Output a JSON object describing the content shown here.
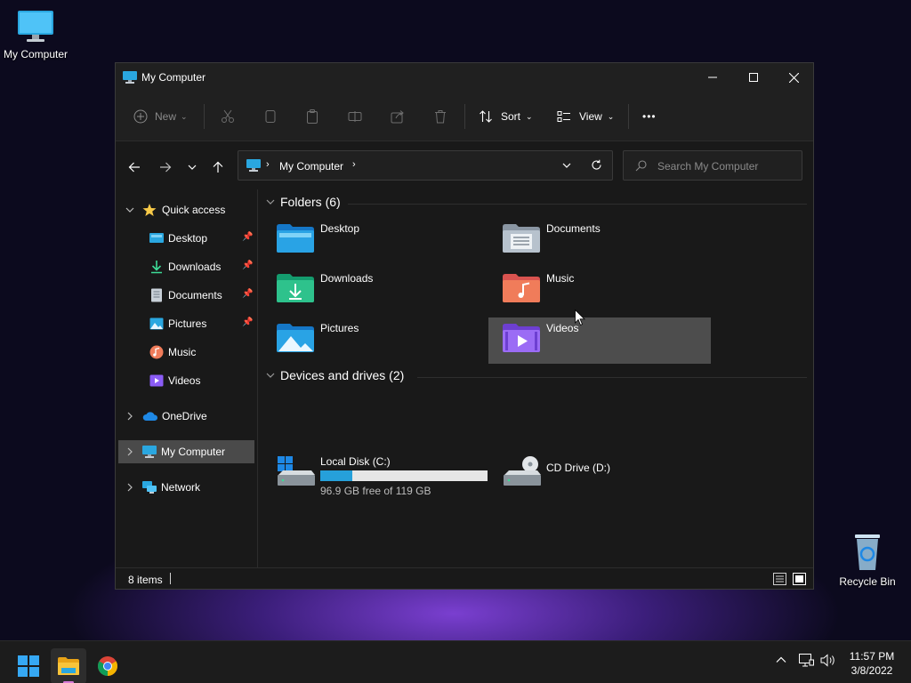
{
  "desktop": {
    "icons": [
      {
        "label": "My Computer",
        "icon": "monitor-icon"
      },
      {
        "label": "Recycle Bin",
        "icon": "recycle-bin-icon"
      }
    ]
  },
  "window": {
    "title": "My Computer",
    "controls": {
      "minimize": "minimize",
      "maximize": "maximize",
      "close": "close"
    }
  },
  "toolbar": {
    "new_label": "New",
    "sort_label": "Sort",
    "view_label": "View",
    "more_label": "•••"
  },
  "address": {
    "crumb": "My Computer",
    "search_placeholder": "Search My Computer"
  },
  "sidebar": {
    "quick_access": "Quick access",
    "quick_items": [
      {
        "label": "Desktop",
        "icon": "desktop-folder-icon"
      },
      {
        "label": "Downloads",
        "icon": "downloads-icon"
      },
      {
        "label": "Documents",
        "icon": "documents-icon"
      },
      {
        "label": "Pictures",
        "icon": "pictures-icon"
      },
      {
        "label": "Music",
        "icon": "music-icon"
      },
      {
        "label": "Videos",
        "icon": "videos-icon"
      }
    ],
    "onedrive": "OneDrive",
    "my_computer": "My Computer",
    "network": "Network"
  },
  "content": {
    "folders_header": "Folders (6)",
    "folders": [
      {
        "name": "Desktop",
        "icon": "desktop-folder-icon"
      },
      {
        "name": "Documents",
        "icon": "documents-folder-icon"
      },
      {
        "name": "Downloads",
        "icon": "downloads-folder-icon"
      },
      {
        "name": "Music",
        "icon": "music-folder-icon"
      },
      {
        "name": "Pictures",
        "icon": "pictures-folder-icon"
      },
      {
        "name": "Videos",
        "icon": "videos-folder-icon"
      }
    ],
    "drives_header": "Devices and drives (2)",
    "drives": [
      {
        "name": "Local Disk (C:)",
        "free_text": "96.9 GB free of 119 GB",
        "used_fraction": 0.19
      },
      {
        "name": "CD Drive (D:)"
      }
    ]
  },
  "status": {
    "item_count": "8 items"
  },
  "taskbar": {
    "time": "11:57 PM",
    "date": "3/8/2022"
  },
  "colors": {
    "accent": "#26a0da",
    "window_bg": "#191919",
    "selected_nav": "#4a4a4a",
    "hover_tile": "#4d4d4d"
  }
}
